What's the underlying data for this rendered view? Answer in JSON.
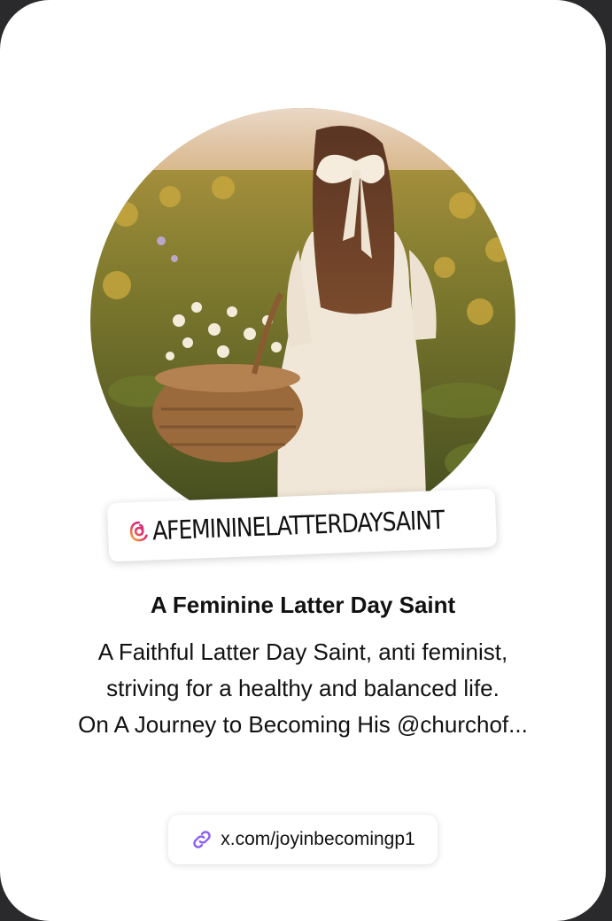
{
  "profile": {
    "handle": "AFEMININELATTERDAYSAINT",
    "display_name": "A Feminine Latter Day Saint",
    "bio_lines": [
      "A Faithful Latter Day Saint, anti feminist,",
      "striving for a healthy and balanced life.",
      "On A Journey to Becoming His @churchof..."
    ],
    "link": "x.com/joyinbecomingp1"
  },
  "icons": {
    "handle_logo": "threads-gradient-icon",
    "link_icon": "chain-link-icon",
    "avatar": "profile-photo"
  },
  "colors": {
    "card_background": "#ffffff",
    "link_icon": "#8b5cf6",
    "text": "#111111"
  }
}
